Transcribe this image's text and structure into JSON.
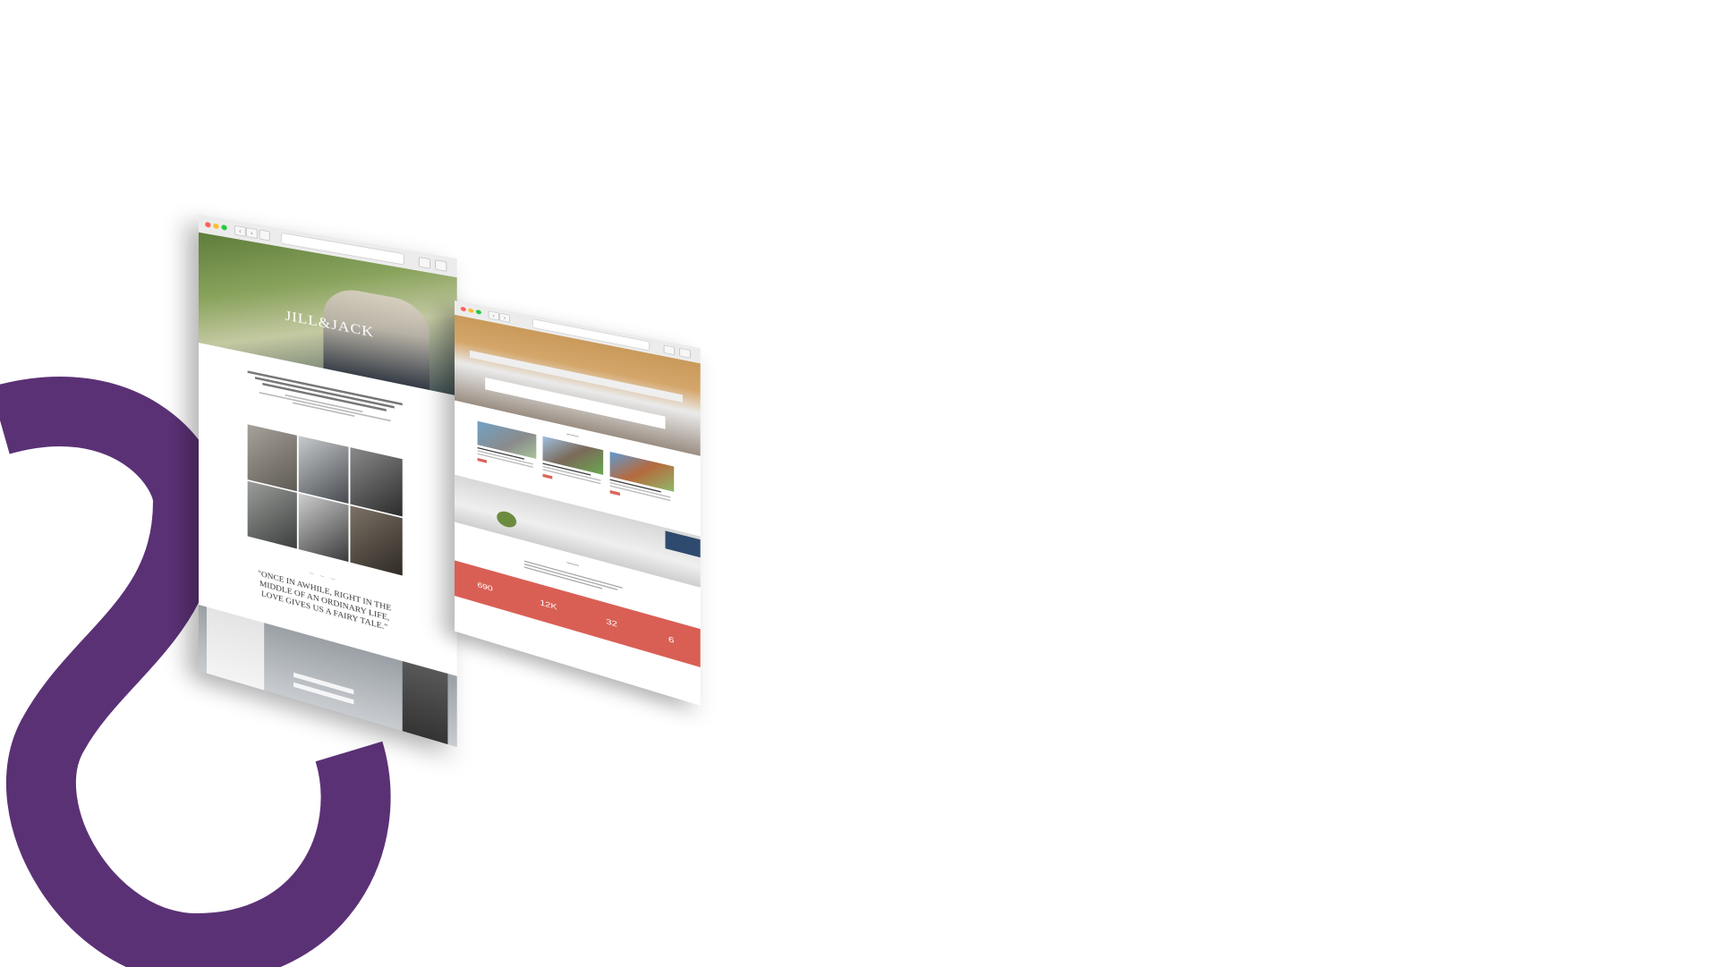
{
  "colors": {
    "swirl": "#5b3176",
    "stats_band": "#d95f55"
  },
  "wedding_site": {
    "monogram": "JILL&JACK",
    "quote": "\"ONCE IN AWHILE, RIGHT IN THE MIDDLE OF AN ORDINARY LIFE, LOVE GIVES US A FAIRY TALE.\""
  },
  "architecture_site": {
    "stats": [
      "690",
      "12K",
      "32",
      "6"
    ]
  }
}
